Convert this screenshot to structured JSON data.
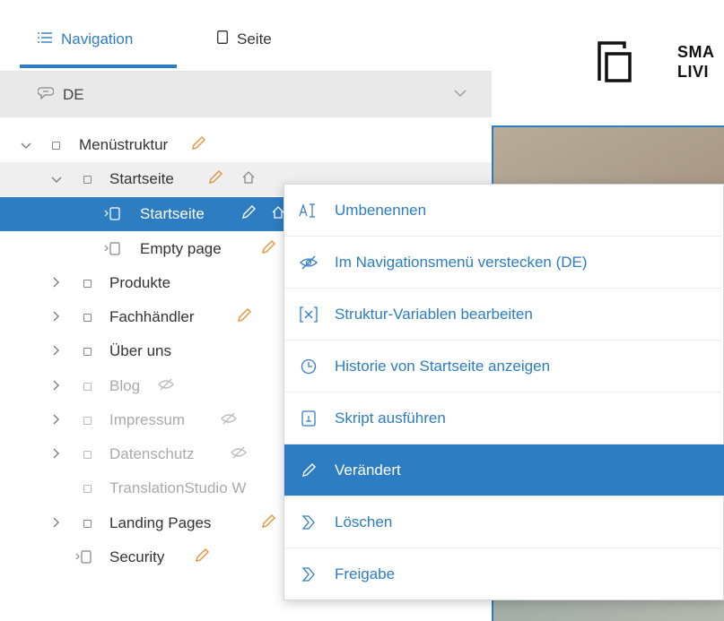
{
  "tabs": {
    "navigation_label": "Navigation",
    "page_label": "Seite"
  },
  "language": {
    "selected": "DE"
  },
  "tree": [
    {
      "label": "Menüstruktur",
      "state": "expanded",
      "edited": true
    },
    {
      "label": "Startseite",
      "state": "expanded",
      "edited": true,
      "home": true
    },
    {
      "label": "Startseite",
      "state": "selected",
      "edited": true,
      "home": true
    },
    {
      "label": "Empty page",
      "edited": true
    },
    {
      "label": "Produkte"
    },
    {
      "label": "Fachhändler",
      "edited": true
    },
    {
      "label": "Über uns"
    },
    {
      "label": "Blog",
      "hidden": true
    },
    {
      "label": "Impressum",
      "hidden": true
    },
    {
      "label": "Datenschutz",
      "hidden": true
    },
    {
      "label": "TranslationStudio W"
    },
    {
      "label": "Landing Pages",
      "edited": true
    },
    {
      "label": "Security",
      "edited": true
    }
  ],
  "preview": {
    "logo_line1": "SMA",
    "logo_line2": "LIVI"
  },
  "context_menu": [
    {
      "label": "Umbenennen",
      "icon": "rename-icon"
    },
    {
      "label": "Im Navigationsmenü verstecken (DE)",
      "icon": "eye-slash-icon"
    },
    {
      "label": "Struktur-Variablen bearbeiten",
      "icon": "variables-icon"
    },
    {
      "label": "Historie von Startseite anzeigen",
      "icon": "clock-icon"
    },
    {
      "label": "Skript ausführen",
      "icon": "script-icon"
    },
    {
      "label": "Verändert",
      "icon": "pencil-icon",
      "active": true
    },
    {
      "label": "Löschen",
      "icon": "workflow-icon"
    },
    {
      "label": "Freigabe",
      "icon": "workflow-icon"
    }
  ],
  "colors": {
    "accent": "#2d7dc2",
    "pencil": "#e0953a",
    "selected_bg": "#2d7dc2"
  }
}
